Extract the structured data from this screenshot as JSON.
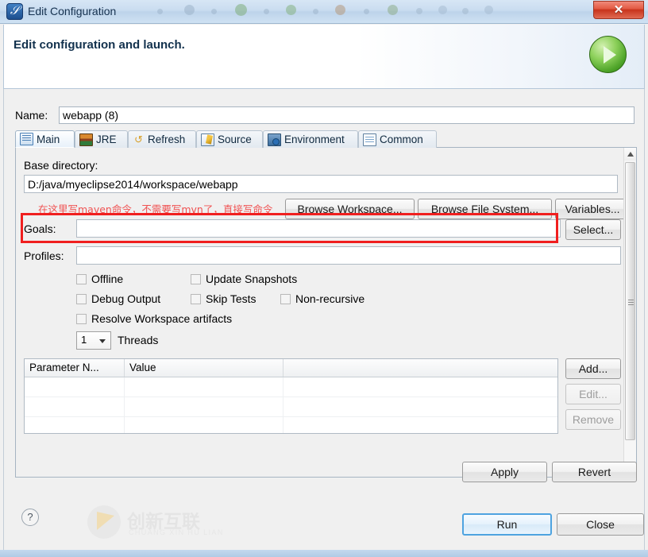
{
  "window": {
    "title": "Edit Configuration",
    "app_icon": "myeclipse-icon",
    "close_label": "✕"
  },
  "header": {
    "title": "Edit configuration and launch.",
    "badge_icon": "run-green-play-icon"
  },
  "name_field": {
    "label": "Name:",
    "value": "webapp (8)",
    "placeholder": ""
  },
  "tabs": [
    {
      "label": "Main",
      "icon": "main-document-icon",
      "active": true
    },
    {
      "label": "JRE",
      "icon": "jre-books-icon",
      "active": false
    },
    {
      "label": "Refresh",
      "icon": "refresh-arrows-icon",
      "active": false
    },
    {
      "label": "Source",
      "icon": "source-pencil-icon",
      "active": false
    },
    {
      "label": "Environment",
      "icon": "environment-icon",
      "active": false
    },
    {
      "label": "Common",
      "icon": "common-list-icon",
      "active": false
    }
  ],
  "main_tab": {
    "base_directory": {
      "label": "Base directory:",
      "value": "D:/java/myeclipse2014/workspace/webapp",
      "placeholder": ""
    },
    "browse_buttons": [
      "Browse Workspace...",
      "Browse File System...",
      "Variables..."
    ],
    "annotation": "在这里写maven命令，不需要写mvn了，直接写命令",
    "annotation_color": "#f05252",
    "highlight_color": "#f01f1f",
    "goals": {
      "label": "Goals:",
      "value": "",
      "placeholder": "",
      "select_button": "Select..."
    },
    "profiles": {
      "label": "Profiles:",
      "value": "",
      "placeholder": ""
    },
    "checkboxes": [
      {
        "label": "Offline",
        "checked": false
      },
      {
        "label": "Update Snapshots",
        "checked": false
      },
      {
        "label": "Debug Output",
        "checked": false
      },
      {
        "label": "Skip Tests",
        "checked": false
      },
      {
        "label": "Non-recursive",
        "checked": false
      },
      {
        "label": "Resolve Workspace artifacts",
        "checked": false
      }
    ],
    "threads": {
      "value": "1",
      "label": "Threads"
    },
    "parameters_table": {
      "columns": [
        "Parameter N...",
        "Value",
        ""
      ],
      "rows": [
        [
          "",
          "",
          ""
        ],
        [
          "",
          "",
          ""
        ],
        [
          "",
          "",
          ""
        ]
      ]
    },
    "table_buttons": [
      {
        "label": "Add...",
        "enabled": true
      },
      {
        "label": "Edit...",
        "enabled": false
      },
      {
        "label": "Remove",
        "enabled": false
      }
    ]
  },
  "action_buttons": {
    "apply": "Apply",
    "revert": "Revert"
  },
  "footer": {
    "help_icon": "question-mark-icon",
    "watermark_cn": "创新互联",
    "watermark_en": "CHUANG XIN HU LIAN",
    "run": "Run",
    "close": "Close"
  }
}
